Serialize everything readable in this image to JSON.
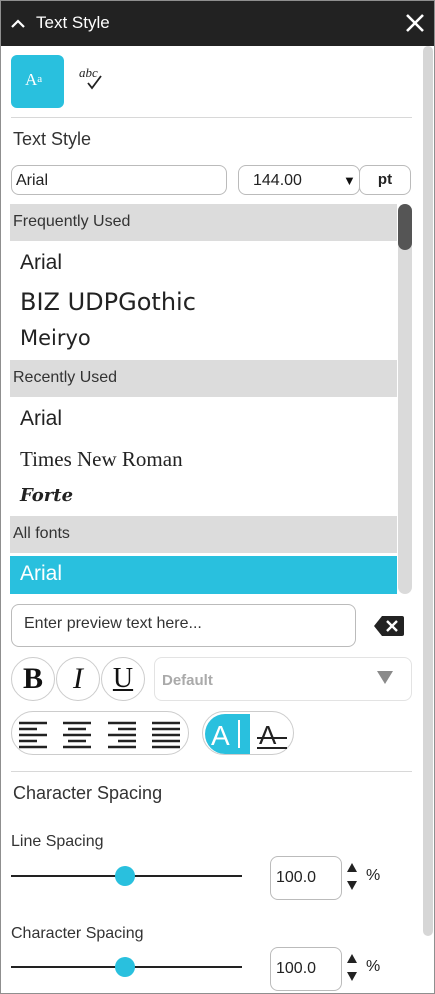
{
  "window": {
    "title": "Text Style"
  },
  "section_text_style": "Text Style",
  "font": {
    "value": "Arial"
  },
  "size": {
    "value": "144.00",
    "unit": "pt"
  },
  "font_list": {
    "frequent_header": "Frequently Used",
    "frequent": [
      "Arial",
      "BIZ UDPGothic",
      "Meiryo"
    ],
    "recent_header": "Recently Used",
    "recent": [
      "Arial",
      "Times New Roman",
      "Forte"
    ],
    "all_header": "All fonts",
    "all": [
      "Arial"
    ]
  },
  "preview": {
    "placeholder": "Enter preview text here..."
  },
  "format": {
    "bold": "B",
    "italic": "I",
    "underline": "U",
    "style_value": "Default"
  },
  "section_char_spacing": "Character Spacing",
  "line_spacing": {
    "label": "Line Spacing",
    "value": "100.0",
    "unit": "%",
    "slider_position": 0.5
  },
  "char_spacing": {
    "label": "Character Spacing",
    "value": "100.0",
    "unit": "%",
    "slider_position": 0.5
  },
  "colors": {
    "accent": "#29c0de",
    "titlebar": "#222222",
    "group_header": "#dcdcdc"
  }
}
